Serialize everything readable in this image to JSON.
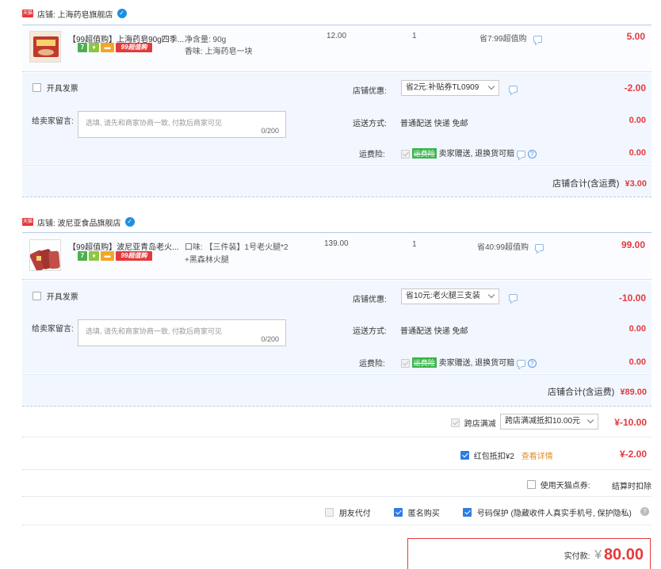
{
  "stores": [
    {
      "store_label": "店铺: 上海药皂旗舰店",
      "tmall_tag": "天猫",
      "item": {
        "title": "【99超值购】上海药皂90g四季...",
        "spec_line1": "净含量: 90g",
        "spec_line2": "香味: 上海药皂一块",
        "unit_price": "12.00",
        "quantity": "1",
        "promo": "省7:99超值购",
        "subtotal": "5.00",
        "badge_7": "7",
        "badge_99": "99超值购"
      },
      "invoice_label": "开具发票",
      "message_label": "给卖家留言:",
      "message_placeholder": "选填, 请先和商家协商一致, 付款后商家可见",
      "message_counter": "0/200",
      "discount_label": "店铺优惠:",
      "discount_select": "省2元:补贴券TL0909",
      "discount_value": "-2.00",
      "shipping_label": "运送方式:",
      "shipping_text": "普通配送 快递 免邮",
      "shipping_value": "0.00",
      "insurance_label": "运费险:",
      "insurance_tag": "运费险",
      "insurance_text": "卖家赠送, 退换货可赔",
      "insurance_value": "0.00",
      "total_label": "店铺合计(含运费)",
      "total_value": "¥3.00"
    },
    {
      "store_label": "店铺: 波尼亚食品旗舰店",
      "tmall_tag": "天猫",
      "item": {
        "title": "【99超值购】波尼亚青岛老火...",
        "spec_line1": "口味: 【三件装】1号老火腿*2",
        "spec_line2": "+黑森林火腿",
        "unit_price": "139.00",
        "quantity": "1",
        "promo": "省40:99超值购",
        "subtotal": "99.00",
        "badge_7": "7",
        "badge_99": "99超值购"
      },
      "invoice_label": "开具发票",
      "message_label": "给卖家留言:",
      "message_placeholder": "选填, 请先和商家协商一致, 付款后商家可见",
      "message_counter": "0/200",
      "discount_label": "店铺优惠:",
      "discount_select": "省10元:老火腿三支装",
      "discount_value": "-10.00",
      "shipping_label": "运送方式:",
      "shipping_text": "普通配送 快递 免邮",
      "shipping_value": "0.00",
      "insurance_label": "运费险:",
      "insurance_tag": "运费险",
      "insurance_text": "卖家赠送, 退换货可赔",
      "insurance_value": "0.00",
      "total_label": "店铺合计(含运费)",
      "total_value": "¥89.00"
    }
  ],
  "cross_store": {
    "label": "跨店满减",
    "select": "跨店满减抵扣10.00元",
    "value": "¥-10.00"
  },
  "red_packet": {
    "label": "红包抵扣¥2",
    "link": "查看详情",
    "value": "¥-2.00"
  },
  "tmall_points": {
    "label": "使用天猫点券:",
    "note": "结算时扣除"
  },
  "options": {
    "friend_pay": "朋友代付",
    "anonymous": "匿名购买",
    "number_protect": "号码保护 (隐藏收件人真实手机号, 保护隐私)"
  },
  "payment": {
    "label": "实付款:",
    "currency": "¥",
    "amount": "80.00"
  },
  "colors": {
    "accent_red": "#e4393c",
    "panel_blue": "#f2f7ff",
    "checkbox_blue": "#2f7de1"
  }
}
